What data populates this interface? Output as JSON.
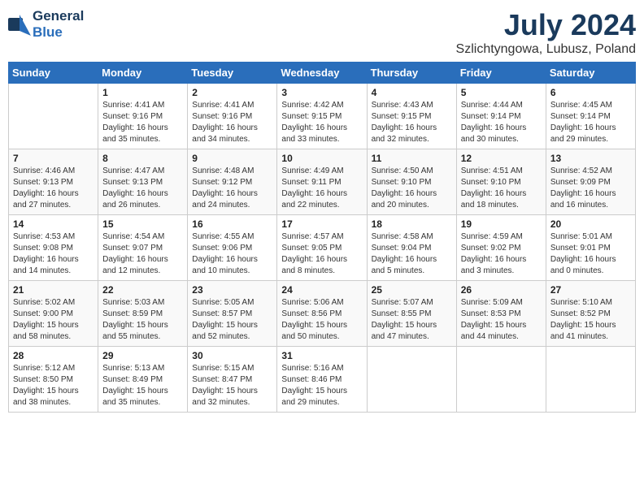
{
  "logo": {
    "general": "General",
    "blue": "Blue"
  },
  "title": {
    "month_year": "July 2024",
    "location": "Szlichtyngowa, Lubusz, Poland"
  },
  "weekdays": [
    "Sunday",
    "Monday",
    "Tuesday",
    "Wednesday",
    "Thursday",
    "Friday",
    "Saturday"
  ],
  "weeks": [
    [
      {
        "day": "",
        "content": ""
      },
      {
        "day": "1",
        "content": "Sunrise: 4:41 AM\nSunset: 9:16 PM\nDaylight: 16 hours\nand 35 minutes."
      },
      {
        "day": "2",
        "content": "Sunrise: 4:41 AM\nSunset: 9:16 PM\nDaylight: 16 hours\nand 34 minutes."
      },
      {
        "day": "3",
        "content": "Sunrise: 4:42 AM\nSunset: 9:15 PM\nDaylight: 16 hours\nand 33 minutes."
      },
      {
        "day": "4",
        "content": "Sunrise: 4:43 AM\nSunset: 9:15 PM\nDaylight: 16 hours\nand 32 minutes."
      },
      {
        "day": "5",
        "content": "Sunrise: 4:44 AM\nSunset: 9:14 PM\nDaylight: 16 hours\nand 30 minutes."
      },
      {
        "day": "6",
        "content": "Sunrise: 4:45 AM\nSunset: 9:14 PM\nDaylight: 16 hours\nand 29 minutes."
      }
    ],
    [
      {
        "day": "7",
        "content": "Sunrise: 4:46 AM\nSunset: 9:13 PM\nDaylight: 16 hours\nand 27 minutes."
      },
      {
        "day": "8",
        "content": "Sunrise: 4:47 AM\nSunset: 9:13 PM\nDaylight: 16 hours\nand 26 minutes."
      },
      {
        "day": "9",
        "content": "Sunrise: 4:48 AM\nSunset: 9:12 PM\nDaylight: 16 hours\nand 24 minutes."
      },
      {
        "day": "10",
        "content": "Sunrise: 4:49 AM\nSunset: 9:11 PM\nDaylight: 16 hours\nand 22 minutes."
      },
      {
        "day": "11",
        "content": "Sunrise: 4:50 AM\nSunset: 9:10 PM\nDaylight: 16 hours\nand 20 minutes."
      },
      {
        "day": "12",
        "content": "Sunrise: 4:51 AM\nSunset: 9:10 PM\nDaylight: 16 hours\nand 18 minutes."
      },
      {
        "day": "13",
        "content": "Sunrise: 4:52 AM\nSunset: 9:09 PM\nDaylight: 16 hours\nand 16 minutes."
      }
    ],
    [
      {
        "day": "14",
        "content": "Sunrise: 4:53 AM\nSunset: 9:08 PM\nDaylight: 16 hours\nand 14 minutes."
      },
      {
        "day": "15",
        "content": "Sunrise: 4:54 AM\nSunset: 9:07 PM\nDaylight: 16 hours\nand 12 minutes."
      },
      {
        "day": "16",
        "content": "Sunrise: 4:55 AM\nSunset: 9:06 PM\nDaylight: 16 hours\nand 10 minutes."
      },
      {
        "day": "17",
        "content": "Sunrise: 4:57 AM\nSunset: 9:05 PM\nDaylight: 16 hours\nand 8 minutes."
      },
      {
        "day": "18",
        "content": "Sunrise: 4:58 AM\nSunset: 9:04 PM\nDaylight: 16 hours\nand 5 minutes."
      },
      {
        "day": "19",
        "content": "Sunrise: 4:59 AM\nSunset: 9:02 PM\nDaylight: 16 hours\nand 3 minutes."
      },
      {
        "day": "20",
        "content": "Sunrise: 5:01 AM\nSunset: 9:01 PM\nDaylight: 16 hours\nand 0 minutes."
      }
    ],
    [
      {
        "day": "21",
        "content": "Sunrise: 5:02 AM\nSunset: 9:00 PM\nDaylight: 15 hours\nand 58 minutes."
      },
      {
        "day": "22",
        "content": "Sunrise: 5:03 AM\nSunset: 8:59 PM\nDaylight: 15 hours\nand 55 minutes."
      },
      {
        "day": "23",
        "content": "Sunrise: 5:05 AM\nSunset: 8:57 PM\nDaylight: 15 hours\nand 52 minutes."
      },
      {
        "day": "24",
        "content": "Sunrise: 5:06 AM\nSunset: 8:56 PM\nDaylight: 15 hours\nand 50 minutes."
      },
      {
        "day": "25",
        "content": "Sunrise: 5:07 AM\nSunset: 8:55 PM\nDaylight: 15 hours\nand 47 minutes."
      },
      {
        "day": "26",
        "content": "Sunrise: 5:09 AM\nSunset: 8:53 PM\nDaylight: 15 hours\nand 44 minutes."
      },
      {
        "day": "27",
        "content": "Sunrise: 5:10 AM\nSunset: 8:52 PM\nDaylight: 15 hours\nand 41 minutes."
      }
    ],
    [
      {
        "day": "28",
        "content": "Sunrise: 5:12 AM\nSunset: 8:50 PM\nDaylight: 15 hours\nand 38 minutes."
      },
      {
        "day": "29",
        "content": "Sunrise: 5:13 AM\nSunset: 8:49 PM\nDaylight: 15 hours\nand 35 minutes."
      },
      {
        "day": "30",
        "content": "Sunrise: 5:15 AM\nSunset: 8:47 PM\nDaylight: 15 hours\nand 32 minutes."
      },
      {
        "day": "31",
        "content": "Sunrise: 5:16 AM\nSunset: 8:46 PM\nDaylight: 15 hours\nand 29 minutes."
      },
      {
        "day": "",
        "content": ""
      },
      {
        "day": "",
        "content": ""
      },
      {
        "day": "",
        "content": ""
      }
    ]
  ]
}
